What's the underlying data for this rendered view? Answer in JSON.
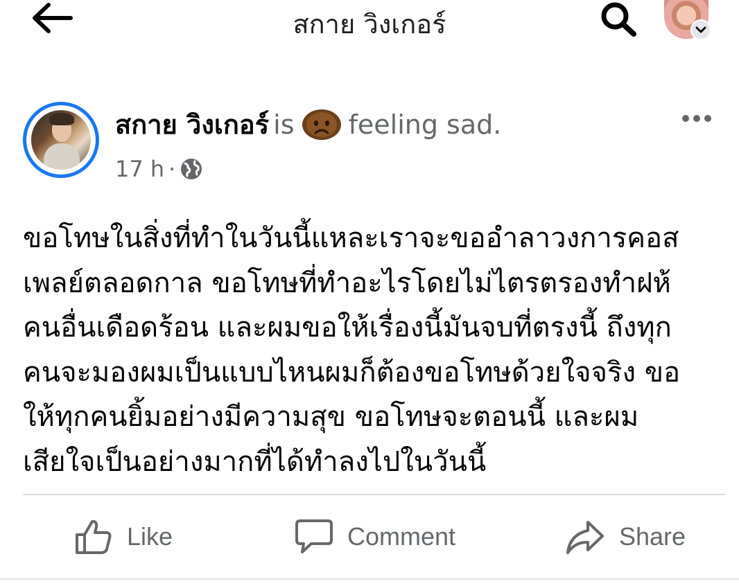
{
  "topbar": {
    "title": "สกาย วิงเกอร์",
    "icons": {
      "back": "back-arrow-icon",
      "search": "search-icon",
      "profile": "profile-avatar",
      "profile_menu": "chevron-down-icon"
    }
  },
  "post": {
    "author": "สกาย วิงเกอร์",
    "is_label": "is",
    "feeling_emoji": "sad-face-emoji",
    "feeling": "feeling sad.",
    "time": "17 h",
    "separator": "·",
    "privacy_icon": "globe-icon",
    "more_icon": "more-options-icon",
    "body_lines": [
      "ขอโทษในสิ่งที่ทำในวันนี้แหละเราจะขออำลาวงการคอส",
      "เพลย์ตลอดกาล ขอโทษที่ทำอะไรโดยไม่ไตรตรองทำฝห้",
      "คนอื่นเดือดร้อน และผมขอให้เรื่องนี้มันจบที่ตรงนี้ ถึงทุก",
      "คนจะมองผมเป็นแบบไหนผมก็ต้องขอโทษด้วยใจจริง ขอ",
      "ให้ทุกคนยิ้มอย่างมีความสุข ขอโทษจะตอนนี้ และผม",
      "เสียใจเป็นอย่างมากที่ได้ทำลงไปในวันนี้"
    ]
  },
  "actions": {
    "like": {
      "label": "Like",
      "icon": "thumbs-up-icon"
    },
    "comment": {
      "label": "Comment",
      "icon": "comment-bubble-icon"
    },
    "share": {
      "label": "Share",
      "icon": "share-arrow-icon"
    }
  },
  "colors": {
    "accent": "#1877f2",
    "text": "#050505",
    "secondary": "#65676b",
    "divider": "#dadde1"
  }
}
